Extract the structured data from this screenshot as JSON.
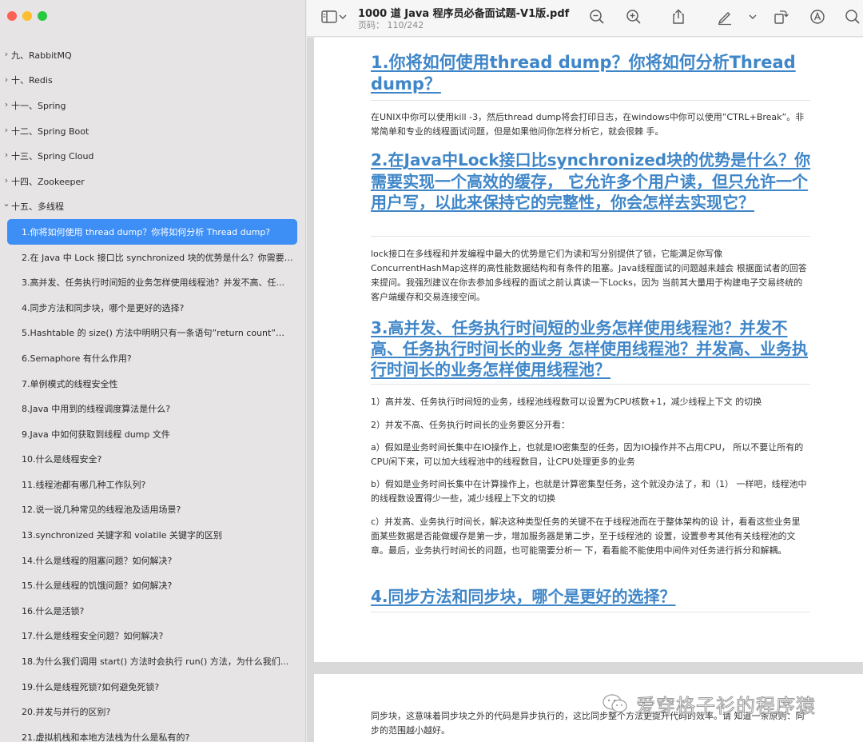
{
  "window": {
    "title": "1000 道 Java 程序员必备面试题-V1版.pdf",
    "page_label": "页码： 110/242"
  },
  "toolbar_icons": [
    "sidebar-icon",
    "chevron-down-icon",
    "zoom-out-icon",
    "zoom-in-icon",
    "share-icon",
    "markup-pen-icon",
    "rotate-icon",
    "annotate-icon",
    "search-icon"
  ],
  "sidebar": {
    "top_items": [
      {
        "label": "九、RabbitMQ"
      },
      {
        "label": "十、Redis"
      },
      {
        "label": "十一、Spring"
      },
      {
        "label": "十二、Spring Boot"
      },
      {
        "label": "十三、Spring Cloud"
      },
      {
        "label": "十四、Zookeeper"
      },
      {
        "label": "十五、多线程"
      }
    ],
    "sub_items": [
      {
        "label": "1.你将如何使用 thread dump？你将如何分析 Thread dump?"
      },
      {
        "label": "2.在 Java 中 Lock 接口比 synchronized 块的优势是什么？你需要实现..."
      },
      {
        "label": "3.高并发、任务执行时间短的业务怎样使用线程池？并发不高、任..."
      },
      {
        "label": "4.同步方法和同步块，哪个是更好的选择?"
      },
      {
        "label": "5.Hashtable 的 size() 方法中明明只有一条语句”return count”，为..."
      },
      {
        "label": "6.Semaphore 有什么作用?"
      },
      {
        "label": "7.单例模式的线程安全性"
      },
      {
        "label": "8.Java 中用到的线程调度算法是什么?"
      },
      {
        "label": "9.Java 中如何获取到线程 dump 文件"
      },
      {
        "label": "10.什么是线程安全?"
      },
      {
        "label": "11.线程池都有哪几种工作队列?"
      },
      {
        "label": "12.说一说几种常见的线程池及适用场景?"
      },
      {
        "label": "13.synchronized 关键字和 volatile 关键字的区别"
      },
      {
        "label": "14.什么是线程的阻塞问题？如何解决?"
      },
      {
        "label": "15.什么是线程的饥饿问题？如何解决?"
      },
      {
        "label": "16.什么是活锁?"
      },
      {
        "label": "17.什么是线程安全问题？如何解决?"
      },
      {
        "label": "18.为什么我们调用 start() 方法时会执行 run() 方法，为什么我们..."
      },
      {
        "label": "19.什么是线程死锁?如何避免死锁?"
      },
      {
        "label": "20.并发与并行的区别?"
      },
      {
        "label": "21.虚拟机栈和本地方法栈为什么是私有的?"
      }
    ],
    "selected_index": 0
  },
  "document": {
    "h1": "1.你将如何使用thread dump？你将如何分析Thread dump？",
    "p1": "在UNIX中你可以使用kill -3，然后thread dump将会打印日志，在windows中你可以使用”CTRL+Break”。非常简单和专业的线程面试问题，但是如果他问你怎样分析它，就会很棘 手。",
    "h2": "2.在Java中Lock接口比synchronized块的优势是什么？你需要实现一个高效的缓存， 它允许多个用户读，但只允许一个用户写，以此来保持它的完整性，你会怎样去实现它？",
    "p2": "lock接口在多线程和并发编程中最大的优势是它们为读和写分别提供了锁，它能满足你写像ConcurrentHashMap这样的高性能数据结构和有条件的阻塞。Java线程面试的问题越来越会 根据面试者的回答来提问。我强烈建议在你去参加多线程的面试之前认真读一下Locks，因为 当前其大量用于构建电子交易终统的客户端缓存和交易连接空间。",
    "h3": "3.高并发、任务执行时间短的业务怎样使用线程池？并发不高、任务执行时间长的业务 怎样使用线程池？并发高、业务执行时间长的业务怎样使用线程池？",
    "p3_1": "1）高并发、任务执行时间短的业务，线程池线程数可以设置为CPU核数+1，减少线程上下文 的切换",
    "p3_2": "2）并发不高、任务执行时间长的业务要区分开看：",
    "p3_a": "a）假如是业务时间长集中在IO操作上，也就是IO密集型的任务，因为IO操作并不占用CPU， 所以不要让所有的CPU闲下来，可以加大线程池中的线程数目，让CPU处理更多的业务",
    "p3_b": "b）假如是业务时间长集中在计算操作上，也就是计算密集型任务，这个就没办法了，和（1） 一样吧，线程池中的线程数设置得少一些，减少线程上下文的切换",
    "p3_c": "c）并发高、业务执行时间长，解决这种类型任务的关键不在于线程池而在于整体架构的设 计，看看这些业务里面某些数据是否能做缓存是第一步，增加服务器是第二步，至于线程池的 设置，设置参考其他有关线程池的文章。最后，业务执行时间长的问题，也可能需要分析一 下，看看能不能使用中间件对任务进行拆分和解耦。",
    "h4": "4.同步方法和同步块，哪个是更好的选择？",
    "p4": "同步块，这意味着同步块之外的代码是异步执行的，这比同步整个方法更提升代码的效率。请 知道一条原则：同步的范围越小越好。"
  },
  "watermark": {
    "text": "爱穿格子衫的程序猿"
  }
}
